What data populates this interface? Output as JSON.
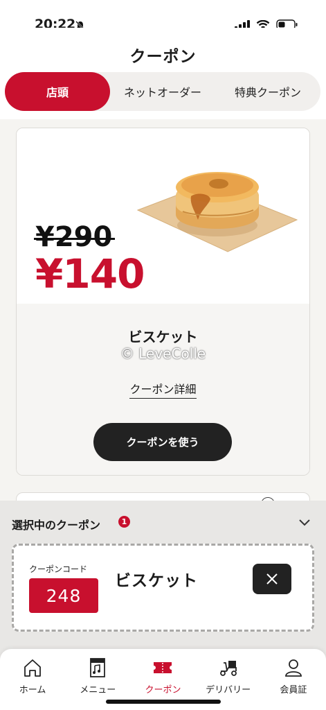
{
  "status_bar": {
    "time": "20:22"
  },
  "header": {
    "title": "クーポン"
  },
  "tabs": [
    {
      "label": "店頭",
      "active": true
    },
    {
      "label": "ネットオーダー",
      "active": false
    },
    {
      "label": "特典クーポン",
      "active": false
    }
  ],
  "coupon": {
    "old_price": "¥290",
    "new_price": "¥140",
    "name": "ビスケット",
    "watermark": "© LeveColle",
    "detail_link": "クーポン詳細",
    "use_button": "クーポンを使う"
  },
  "selected": {
    "title": "選択中のクーポン",
    "count": "1",
    "code_label": "クーポンコード",
    "code": "248",
    "name": "ビスケット"
  },
  "nav": [
    {
      "label": "ホーム",
      "icon": "home-icon"
    },
    {
      "label": "メニュー",
      "icon": "menu-book-icon"
    },
    {
      "label": "クーポン",
      "icon": "coupon-icon",
      "active": true
    },
    {
      "label": "デリバリー",
      "icon": "delivery-scooter-icon"
    },
    {
      "label": "会員証",
      "icon": "member-icon"
    }
  ],
  "colors": {
    "accent": "#c8102e",
    "dark": "#222222"
  }
}
